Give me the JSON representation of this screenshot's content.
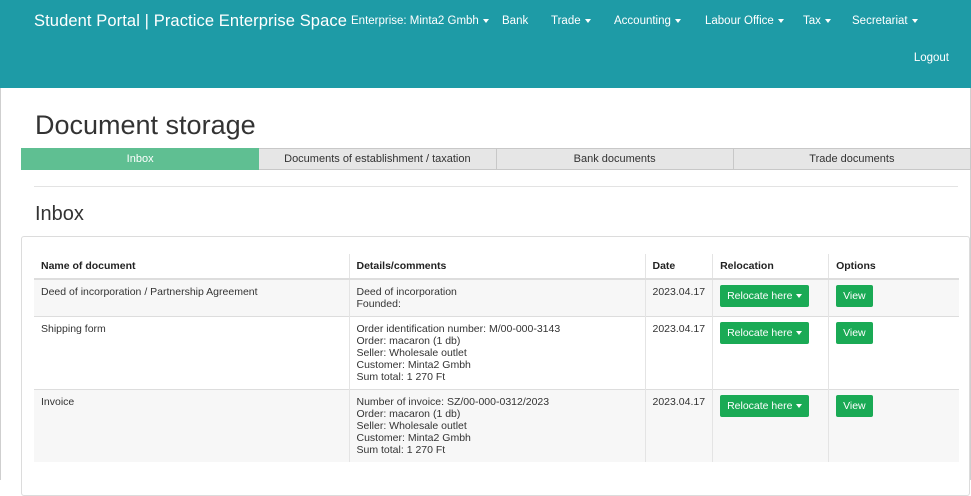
{
  "header": {
    "brand": "Student Portal | Practice Enterprise Space",
    "nav": [
      {
        "label": "Enterprise: Minta2 Gmbh",
        "dropdown": true
      },
      {
        "label": "Bank",
        "dropdown": false
      },
      {
        "label": "Trade",
        "dropdown": true
      },
      {
        "label": "Accounting",
        "dropdown": true
      },
      {
        "label": "Labour Office",
        "dropdown": true
      },
      {
        "label": "Tax",
        "dropdown": true
      },
      {
        "label": "Secretariat",
        "dropdown": true
      }
    ],
    "logout": "Logout"
  },
  "page_title": "Document storage",
  "tabs": [
    {
      "label": "Inbox",
      "active": true
    },
    {
      "label": "Documents of establishment / taxation",
      "active": false
    },
    {
      "label": "Bank documents",
      "active": false
    },
    {
      "label": "Trade documents",
      "active": false
    }
  ],
  "section_title": "Inbox",
  "table": {
    "columns": [
      "Name of document",
      "Details/comments",
      "Date",
      "Relocation",
      "Options"
    ],
    "rows": [
      {
        "name": "Deed of incorporation / Partnership Agreement",
        "details": [
          "Deed of incorporation",
          "Founded:"
        ],
        "date": "2023.04.17",
        "relocate_label": "Relocate here",
        "view_label": "View"
      },
      {
        "name": "Shipping form",
        "details": [
          "Order identification number: M/00-000-3143",
          "Order: macaron (1 db)",
          "Seller: Wholesale outlet",
          "Customer: Minta2 Gmbh",
          "Sum total: 1 270 Ft"
        ],
        "date": "2023.04.17",
        "relocate_label": "Relocate here",
        "view_label": "View"
      },
      {
        "name": "Invoice",
        "details": [
          "Number of invoice: SZ/00-000-0312/2023",
          "Order: macaron (1 db)",
          "Seller: Wholesale outlet",
          "Customer: Minta2 Gmbh",
          "Sum total: 1 270 Ft"
        ],
        "date": "2023.04.17",
        "relocate_label": "Relocate here",
        "view_label": "View"
      }
    ]
  },
  "colors": {
    "navbar": "#1e9ba6",
    "active_tab": "#5fbf92",
    "button": "#1aaa55"
  }
}
